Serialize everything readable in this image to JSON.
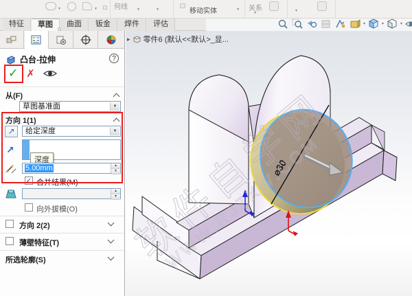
{
  "ribbon": {
    "tabs": [
      {
        "label": "特征"
      },
      {
        "label": "草图"
      },
      {
        "label": "曲面"
      },
      {
        "label": "钣金"
      },
      {
        "label": "焊件"
      },
      {
        "label": "评估"
      }
    ],
    "active_tab": "草图",
    "partial_labels": {
      "construction_line": "何线",
      "move_entities": "移动实体",
      "relations": "关系"
    }
  },
  "headsup_icons": [
    "zoom-to-fit",
    "zoom-to-area",
    "previous-view",
    "section-view",
    "view-settings",
    "view-orientation",
    "display-style",
    "hide-show-items"
  ],
  "panel": {
    "tab_icons": [
      "feature-manager-tree",
      "property-manager",
      "configuration-manager",
      "dimxpert-manager",
      "display-manager"
    ],
    "title": "凸台-拉伸",
    "help_label": "?",
    "from_group": {
      "header": "从(F)",
      "plane_value": "草图基准面"
    },
    "direction1": {
      "header": "方向 1(1)",
      "end_condition": "给定深度",
      "direction_tooltip": "深度",
      "depth_value": "5.00mm",
      "merge_label": "合并结果(M)",
      "merge_checked": true,
      "draft_field_value": "",
      "draft_outward_label": "向外拔模(O)",
      "draft_outward_checked": false
    },
    "direction2": {
      "header": "方向 2(2)",
      "checked": false
    },
    "thin_feature": {
      "header": "薄壁特征(T)",
      "checked": false
    },
    "selected_contours": {
      "header": "所选轮廓(S)"
    }
  },
  "viewport": {
    "part_label": "零件6 (默认<<默认>_显...",
    "dimension_label": "⌀30",
    "watermark": {
      "line1": "软件自学网",
      "line2": "WWW.RJZXW.COM"
    }
  },
  "icons": {
    "ok": "✓",
    "cancel": "✗",
    "flyout": "▸",
    "dropdown": "▼",
    "spinner_up": "▴",
    "spinner_down": "▾",
    "check": "✓",
    "direction_arrow": "↗"
  },
  "colors": {
    "annotation_red": "#ee1c1c",
    "selection_blue": "#3297fd",
    "preview_yellow": "#e9d74b",
    "sketch_blue": "#58aeee",
    "model_lavender": "#cdbbd9",
    "preview_tan": "#c2b483"
  }
}
